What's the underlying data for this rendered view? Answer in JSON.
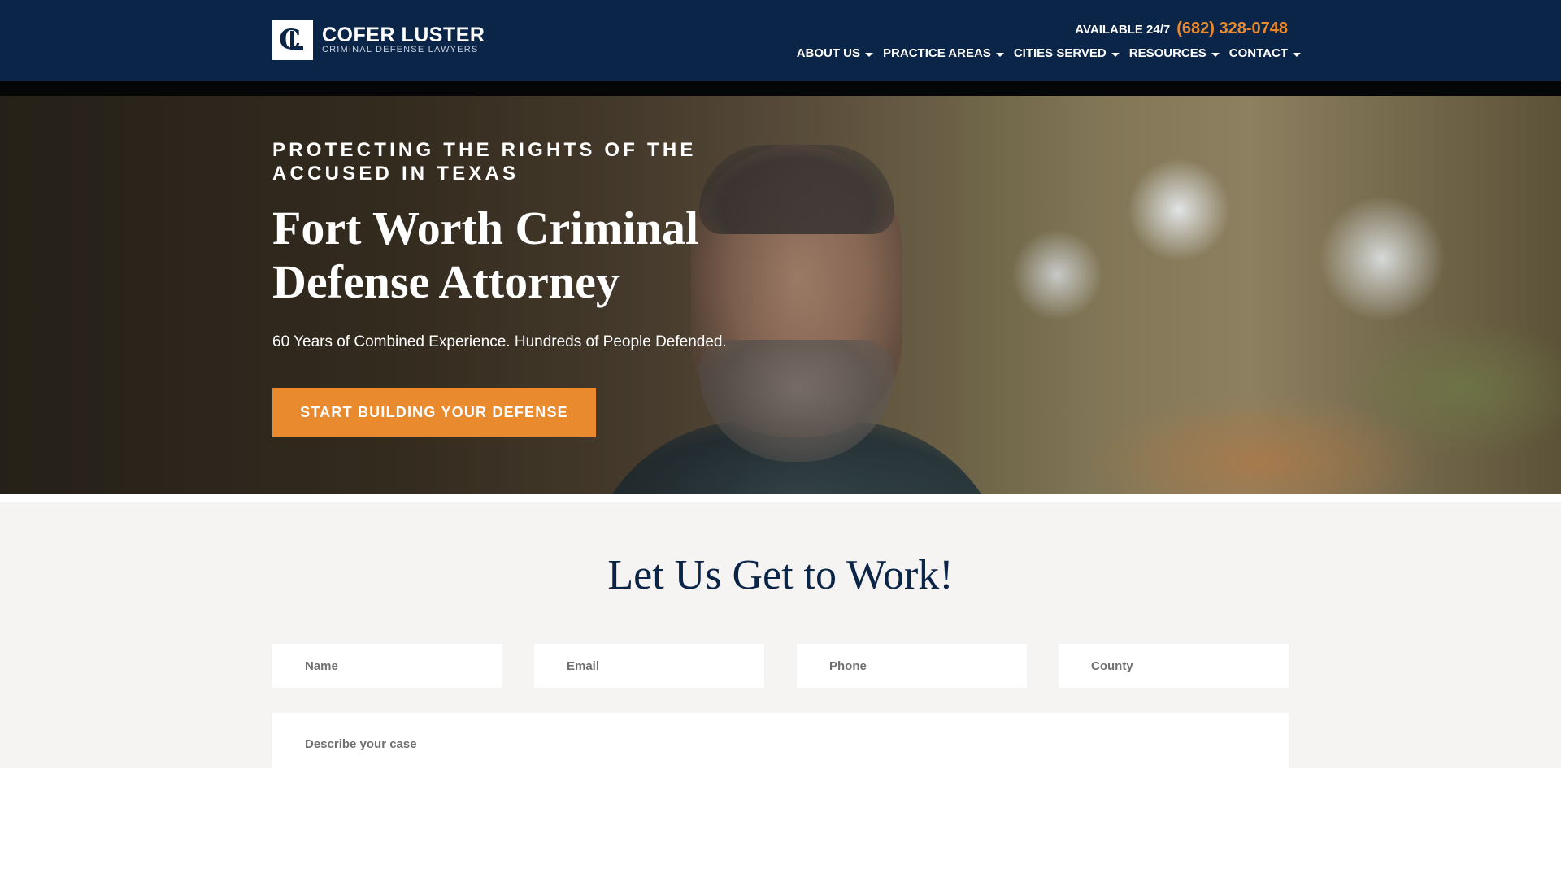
{
  "header": {
    "logo": {
      "mark": "CL",
      "name": "COFER LUSTER",
      "subtitle": "CRIMINAL DEFENSE LAWYERS"
    },
    "availability": "AVAILABLE 24/7",
    "phone": "(682) 328-0748",
    "nav": [
      {
        "label": "ABOUT US",
        "has_dropdown": true
      },
      {
        "label": "PRACTICE AREAS",
        "has_dropdown": true
      },
      {
        "label": "CITIES SERVED",
        "has_dropdown": true
      },
      {
        "label": "RESOURCES",
        "has_dropdown": true
      },
      {
        "label": "CONTACT",
        "has_dropdown": true
      }
    ]
  },
  "hero": {
    "eyebrow": "PROTECTING THE RIGHTS OF THE ACCUSED IN TEXAS",
    "headline": "Fort Worth Criminal Defense Attorney",
    "subhead": "60 Years of Combined Experience. Hundreds of People Defended.",
    "cta_label": "START BUILDING YOUR DEFENSE"
  },
  "form": {
    "title": "Let Us Get to Work!",
    "name_placeholder": "Name",
    "email_placeholder": "Email",
    "phone_placeholder": "Phone",
    "county_placeholder": "County",
    "case_placeholder": "Describe your case"
  },
  "colors": {
    "navy": "#0b2548",
    "accent_orange": "#e88a2d",
    "form_background": "#f6f4f2"
  }
}
